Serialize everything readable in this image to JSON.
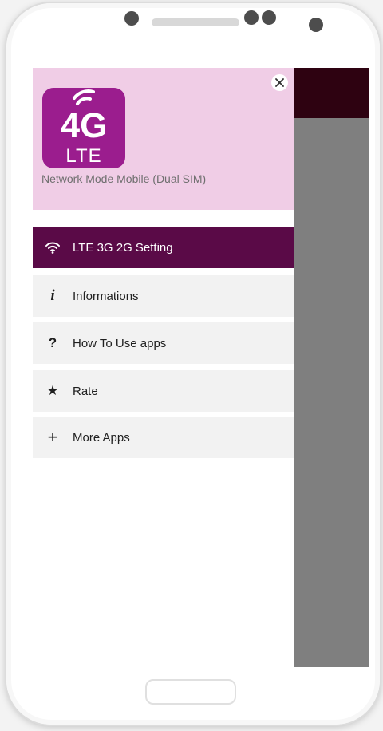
{
  "app": {
    "logo_big": "4G",
    "logo_small": "LTE",
    "subtitle": "Network Mode Mobile (Dual SIM)"
  },
  "drawer": {
    "items": [
      {
        "label": "LTE  3G  2G Setting",
        "icon": "wifi-icon"
      },
      {
        "label": "Informations",
        "icon": "info-icon",
        "glyph": "i"
      },
      {
        "label": "How To Use apps",
        "icon": "question-icon",
        "glyph": "?"
      },
      {
        "label": "Rate",
        "icon": "star-icon",
        "glyph": "★"
      },
      {
        "label": "More Apps",
        "icon": "plus-icon",
        "glyph": "+"
      }
    ]
  },
  "colors": {
    "header_bg": "#f0cde6",
    "logo_bg": "#9b1d8e",
    "active_item_bg": "#5a0a47",
    "app_toolbar": "#2e0211",
    "scrim": "#7f7f7f"
  }
}
